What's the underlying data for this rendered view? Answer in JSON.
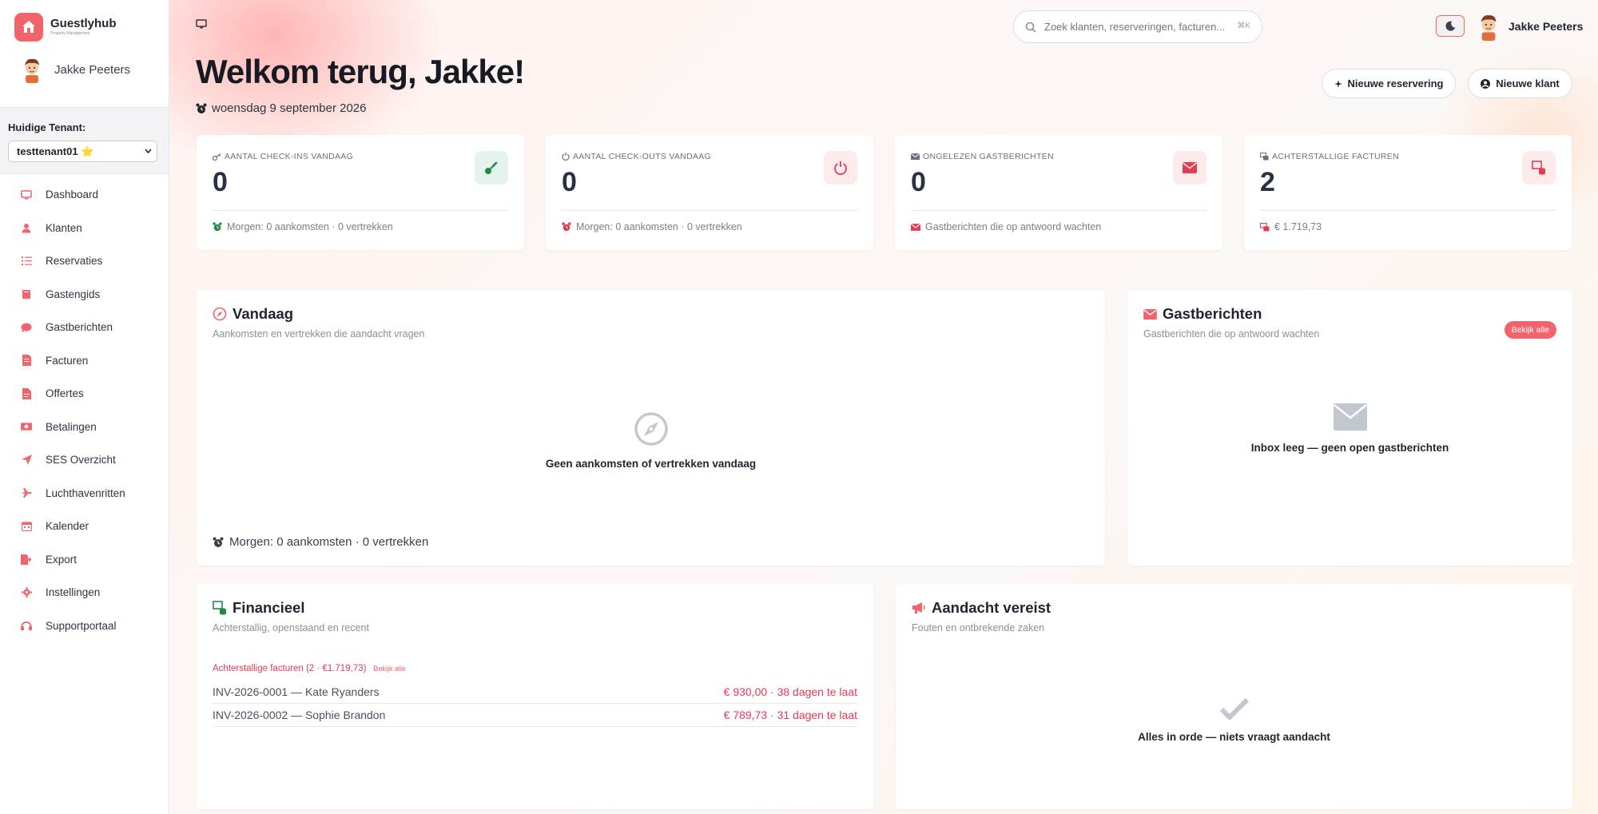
{
  "brand": {
    "name": "Guestlyhub",
    "tagline": "Property Management",
    "color": "#f1646c"
  },
  "user": {
    "name": "Jakke Peeters"
  },
  "tenant": {
    "label": "Huidige Tenant:",
    "selected": "testtenant01 ⭐"
  },
  "nav": [
    {
      "label": "Dashboard",
      "icon": "monitor-icon"
    },
    {
      "label": "Klanten",
      "icon": "user-icon"
    },
    {
      "label": "Reservaties",
      "icon": "list-icon"
    },
    {
      "label": "Gastengids",
      "icon": "book-icon"
    },
    {
      "label": "Gastberichten",
      "icon": "chat-icon"
    },
    {
      "label": "Facturen",
      "icon": "invoice-icon"
    },
    {
      "label": "Offertes",
      "icon": "file-icon"
    },
    {
      "label": "Betalingen",
      "icon": "money-icon"
    },
    {
      "label": "SES Overzicht",
      "icon": "send-icon"
    },
    {
      "label": "Luchthavenritten",
      "icon": "plane-icon"
    },
    {
      "label": "Kalender",
      "icon": "calendar-icon"
    },
    {
      "label": "Export",
      "icon": "export-icon"
    },
    {
      "label": "Instellingen",
      "icon": "gear-icon"
    },
    {
      "label": "Supportportaal",
      "icon": "support-icon"
    }
  ],
  "header": {
    "search_placeholder": "Zoek klanten, reserveringen, facturen...",
    "search_shortcut": "⌘K",
    "welcome": "Welkom terug, Jakke!",
    "date": "woensdag 9 september 2026",
    "btn_new_reservation": "Nieuwe reservering",
    "btn_new_client": "Nieuwe klant"
  },
  "stats": [
    {
      "label": "AANTAL CHECK-INS VANDAAG",
      "value": "0",
      "foot": "Morgen: 0 aankomsten · 0 vertrekken",
      "icon": "key-icon",
      "badge_color": "#e4f4ec",
      "icon_color": "#1f8a4c"
    },
    {
      "label": "AANTAL CHECK-OUTS VANDAAG",
      "value": "0",
      "foot": "Morgen: 0 aankomsten · 0 vertrekken",
      "icon": "power-icon",
      "badge_color": "#fdeaea",
      "icon_color": "#e23b53"
    },
    {
      "label": "ONGELEZEN GASTBERICHTEN",
      "value": "0",
      "foot": "Gastberichten die op antwoord wachten",
      "icon": "envelope-icon",
      "badge_color": "#fdeaea",
      "icon_color": "#e23b53"
    },
    {
      "label": "ACHTERSTALLIGE FACTUREN",
      "value": "2",
      "foot": "€ 1.719,73",
      "icon": "invoice-stack-icon",
      "badge_color": "#fdeaea",
      "icon_color": "#e23b53"
    }
  ],
  "today": {
    "title": "Vandaag",
    "subtitle": "Aankomsten en vertrekken die aandacht vragen",
    "empty": "Geen aankomsten of vertrekken vandaag",
    "tomorrow": "Morgen: 0 aankomsten · 0 vertrekken"
  },
  "messages": {
    "title": "Gastberichten",
    "subtitle": "Gastberichten die op antwoord wachten",
    "view_all": "Bekijk alle",
    "empty": "Inbox leeg — geen open gastberichten"
  },
  "finance": {
    "title": "Financieel",
    "subtitle": "Achterstallig, openstaand en recent",
    "overdue_header": "Achterstallige facturen (2 · €1.719,73)",
    "view_all": "Bekijk alle",
    "invoices": [
      {
        "left": "INV-2026-0001 — Kate Ryanders",
        "right": "€ 930,00 · 38 dagen te laat"
      },
      {
        "left": "INV-2026-0002 — Sophie Brandon",
        "right": "€ 789,73 · 31 dagen te laat"
      }
    ]
  },
  "attention": {
    "title": "Aandacht vereist",
    "subtitle": "Fouten en ontbrekende zaken",
    "empty": "Alles in orde — niets vraagt aandacht"
  },
  "colors": {
    "accent": "#f1646c",
    "danger": "#e23b53",
    "success": "#1f8a4c"
  }
}
